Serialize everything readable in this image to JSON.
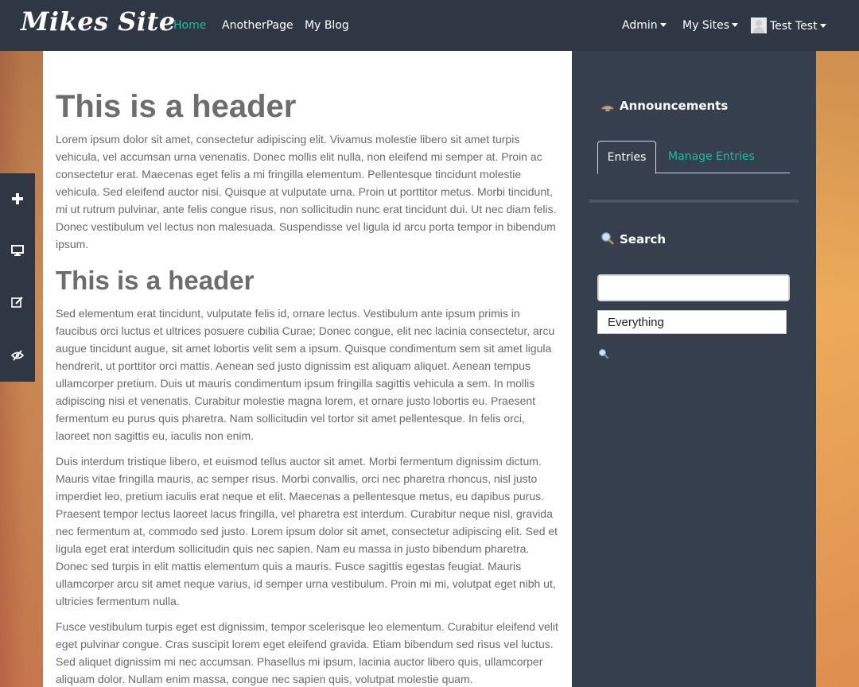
{
  "nav": {
    "brand": "Mikes Site",
    "links": [
      "Home",
      "AnotherPage",
      "My Blog"
    ],
    "admin": "Admin",
    "my_sites": "My Sites",
    "user": "Test Test"
  },
  "side_tools": [
    {
      "icon": "plus-icon"
    },
    {
      "icon": "monitor-icon"
    },
    {
      "icon": "edit-icon"
    },
    {
      "icon": "eye-slash-icon"
    }
  ],
  "main": {
    "header1": "This is a header",
    "para1": "Lorem ipsum dolor sit amet, consectetur adipiscing elit. Vivamus molestie libero sit amet turpis vehicula, vel accumsan urna venenatis. Donec mollis elit nulla, non eleifend mi semper at. Proin ac consectetur erat. Maecenas eget felis a mi fringilla elementum. Pellentesque tincidunt molestie vehicula. Sed eleifend auctor nisi. Quisque at vulputate urna. Proin ut porttitor metus. Morbi tincidunt, mi ut rutrum pulvinar, ante felis congue risus, non sollicitudin nunc erat tincidunt dui. Ut nec diam felis. Donec vestibulum vel lectus non malesuada. Suspendisse vel ligula id arcu porta tempor in bibendum ipsum.",
    "header2": "This is a header",
    "para2": "Sed elementum erat tincidunt, vulputate felis id, ornare lectus. Vestibulum ante ipsum primis in faucibus orci luctus et ultrices posuere cubilia Curae; Donec congue, elit nec lacinia consectetur, arcu augue tincidunt augue, sit amet lobortis velit sem a ipsum. Quisque condimentum sem sit amet ligula hendrerit, ut porttitor orci mattis. Aenean sed justo dignissim est aliquam aliquet. Aenean tempus ullamcorper pretium. Duis ut mauris condimentum ipsum fringilla sagittis vehicula a sem. In mollis adipiscing nisi et venenatis. Curabitur molestie magna lorem, et ornare justo lobortis eu. Praesent fermentum eu purus quis pharetra. Nam sollicitudin vel tortor sit amet pellentesque. In felis orci, laoreet non sagittis eu, iaculis non enim.",
    "para3": "Duis interdum tristique libero, et euismod tellus auctor sit amet. Morbi fermentum dignissim dictum. Mauris vitae fringilla mauris, ac semper risus. Morbi convallis, orci nec pharetra rhoncus, nisl justo imperdiet leo, pretium iaculis erat neque et elit. Maecenas a pellentesque metus, eu dapibus purus. Praesent tempor lectus laoreet lacus fringilla, vel pharetra est interdum. Curabitur neque nisl, gravida nec fermentum at, commodo sed justo. Lorem ipsum dolor sit amet, consectetur adipiscing elit. Sed et ligula eget erat interdum sollicitudin quis nec sapien. Nam eu massa in justo bibendum pharetra. Donec sed turpis in elit mattis elementum quis a mauris. Fusce sagittis egestas feugiat. Mauris ullamcorper arcu sit amet neque varius, id semper urna vestibulum. Proin mi mi, volutpat eget nibh ut, ultricies fermentum nulla.",
    "para4": "Fusce vestibulum turpis eget est dignissim, tempor scelerisque leo elementum. Curabitur eleifend velit eget pulvinar congue. Cras suscipit lorem eget eleifend gravida. Etiam bibendum sed risus vel luctus. Sed aliquet dignissim mi nec accumsan. Phasellus mi ipsum, lacinia auctor libero quis, ullamcorper aliquam dolor. Nullam enim massa, congue nec sapien quis, volutpat molestie quam."
  },
  "sidebar": {
    "announcements_title": "Announcements",
    "tab_entries": "Entries",
    "tab_manage": "Manage Entries",
    "search_title": "Search",
    "search_value": "",
    "search_scope": "Everything"
  },
  "colors": {
    "accent": "#1abc9c",
    "navbar": "#2f3745",
    "sidebar": "#353f4d"
  }
}
